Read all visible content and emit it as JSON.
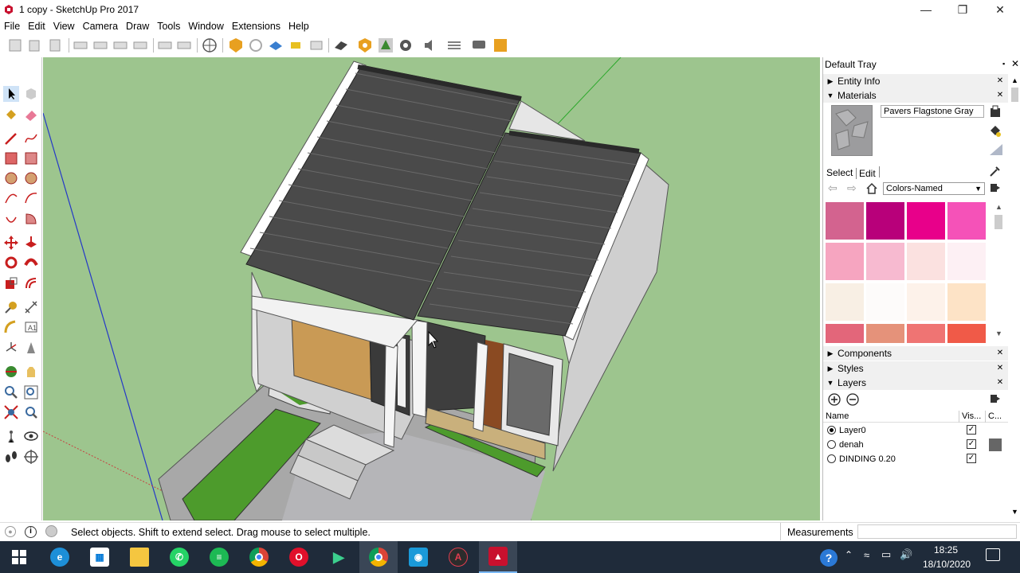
{
  "window": {
    "title": "1 copy - SketchUp Pro 2017"
  },
  "menu": [
    "File",
    "Edit",
    "View",
    "Camera",
    "Draw",
    "Tools",
    "Window",
    "Extensions",
    "Help"
  ],
  "tray": {
    "title": "Default Tray",
    "entity_info": "Entity Info",
    "materials": {
      "label": "Materials",
      "current_name": "Pavers Flagstone Gray",
      "select_tab": "Select",
      "edit_tab": "Edit",
      "library": "Colors-Named",
      "swatches": [
        "#d3638f",
        "#b8007a",
        "#e8008a",
        "#f552b8",
        "#f6a5c0",
        "#f7bad0",
        "#fbe1e0",
        "#fdf0f4",
        "#f8efe4",
        "#fdfbfa",
        "#fdf2ea",
        "#fde3c6",
        "#e3667a",
        "#e5927a",
        "#ef7473",
        "#f05a48"
      ]
    },
    "components": "Components",
    "styles": "Styles",
    "layers": {
      "label": "Layers",
      "col_name": "Name",
      "col_vis": "Vis...",
      "col_color": "C...",
      "rows": [
        {
          "name": "Layer0",
          "active": true,
          "visible": true
        },
        {
          "name": "denah",
          "active": false,
          "visible": true
        },
        {
          "name": "DINDING 0.20",
          "active": false,
          "visible": true
        }
      ]
    }
  },
  "status": {
    "hint": "Select objects. Shift to extend select. Drag mouse to select multiple.",
    "measurements_label": "Measurements",
    "measurements_value": ""
  },
  "taskbar": {
    "time": "18:25",
    "date": "18/10/2020"
  },
  "colors": {
    "viewport_bg": "#9dc58e",
    "taskbar_bg": "#1f2b3a",
    "roof": "#4a4a4a"
  }
}
